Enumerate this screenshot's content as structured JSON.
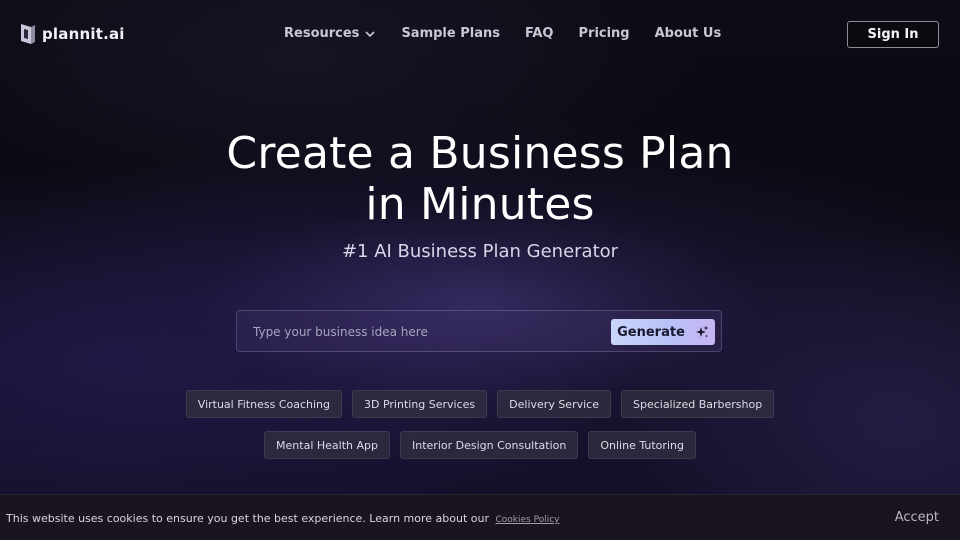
{
  "header": {
    "logo_text": "plannit.ai",
    "nav": [
      {
        "label": "Resources",
        "has_dropdown": true
      },
      {
        "label": "Sample Plans"
      },
      {
        "label": "FAQ"
      },
      {
        "label": "Pricing"
      },
      {
        "label": "About Us"
      }
    ],
    "sign_in_label": "Sign In"
  },
  "hero": {
    "title_line1": "Create a Business Plan",
    "title_line2": "in Minutes",
    "subtitle": "#1 AI Business Plan Generator"
  },
  "search": {
    "placeholder": "Type your business idea here",
    "value": "",
    "generate_label": "Generate",
    "generate_icon": "sparkles-icon"
  },
  "suggestions": {
    "row1": [
      "Virtual Fitness Coaching",
      "3D Printing Services",
      "Delivery Service",
      "Specialized Barbershop"
    ],
    "row2": [
      "Mental Health App",
      "Interior Design Consultation",
      "Online Tutoring"
    ]
  },
  "cookie_banner": {
    "text": "This website uses cookies to ensure you get the best experience. Learn more about our",
    "link_label": "Cookies Policy",
    "accept_label": "Accept"
  },
  "colors": {
    "background": "#0b0a12",
    "accent_glow": "#4e3e8c",
    "generate_button": "#c0cbf8",
    "cookie_bar": "#1a141f"
  }
}
